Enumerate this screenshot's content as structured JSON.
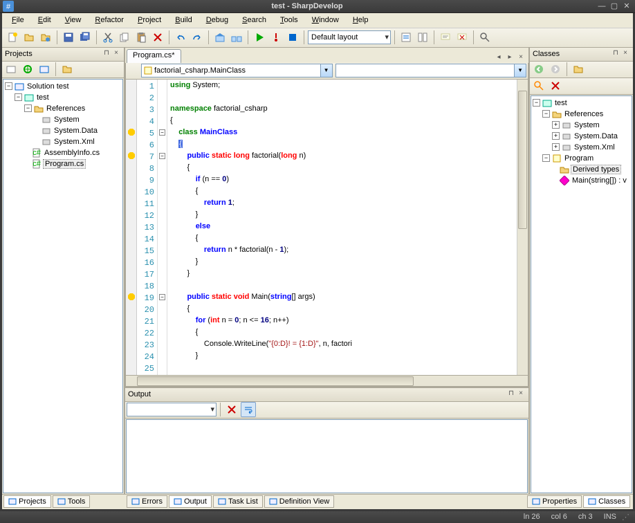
{
  "title": "test - SharpDevelop",
  "menu": [
    "File",
    "Edit",
    "View",
    "Refactor",
    "Project",
    "Build",
    "Debug",
    "Search",
    "Tools",
    "Window",
    "Help"
  ],
  "layout_combo": "Default layout",
  "projects_panel": {
    "title": "Projects",
    "solution": "Solution test",
    "project": "test",
    "references_label": "References",
    "refs": [
      "System",
      "System.Data",
      "System.Xml"
    ],
    "files": [
      "AssemblyInfo.cs",
      "Program.cs"
    ]
  },
  "classes_panel": {
    "title": "Classes",
    "root": "test",
    "references_label": "References",
    "refs": [
      "System",
      "System.Data",
      "System.Xml"
    ],
    "program": "Program",
    "derived": "Derived types",
    "main": "Main(string[]) : v"
  },
  "editor": {
    "tab": "Program.cs*",
    "class_combo": "factorial_csharp.MainClass",
    "lines": [
      {
        "n": 1,
        "tokens": [
          [
            "kw-green",
            "using"
          ],
          [
            "",
            " System;"
          ]
        ]
      },
      {
        "n": 2,
        "tokens": []
      },
      {
        "n": 3,
        "tokens": [
          [
            "kw-green",
            "namespace"
          ],
          [
            "",
            " factorial_csharp"
          ]
        ]
      },
      {
        "n": 4,
        "tokens": [
          [
            "",
            "{"
          ]
        ]
      },
      {
        "n": 5,
        "fold": true,
        "tokens": [
          [
            "",
            "    "
          ],
          [
            "kw-green",
            "class"
          ],
          [
            "",
            " "
          ],
          [
            "kw-blue",
            "MainClass"
          ]
        ]
      },
      {
        "n": 6,
        "tokens": [
          [
            "",
            "    "
          ],
          [
            "highlight-brace",
            "{"
          ]
        ]
      },
      {
        "n": 7,
        "fold": true,
        "tokens": [
          [
            "",
            "        "
          ],
          [
            "kw-blue",
            "public"
          ],
          [
            "",
            " "
          ],
          [
            "kw-red",
            "static"
          ],
          [
            "",
            " "
          ],
          [
            "kw-red",
            "long"
          ],
          [
            "",
            " "
          ],
          [
            "",
            "factorial"
          ],
          [
            "",
            "("
          ],
          [
            "kw-red",
            "long"
          ],
          [
            "",
            " n)"
          ]
        ]
      },
      {
        "n": 8,
        "tokens": [
          [
            "",
            "        {"
          ]
        ]
      },
      {
        "n": 9,
        "tokens": [
          [
            "",
            "            "
          ],
          [
            "kw-blue",
            "if"
          ],
          [
            "",
            " (n == "
          ],
          [
            "num",
            "0"
          ],
          [
            "",
            ")"
          ]
        ]
      },
      {
        "n": 10,
        "tokens": [
          [
            "",
            "            {"
          ]
        ]
      },
      {
        "n": 11,
        "tokens": [
          [
            "",
            "                "
          ],
          [
            "kw-blue",
            "return"
          ],
          [
            "",
            " "
          ],
          [
            "num",
            "1"
          ],
          [
            "",
            ";"
          ]
        ]
      },
      {
        "n": 12,
        "tokens": [
          [
            "",
            "            }"
          ]
        ]
      },
      {
        "n": 13,
        "tokens": [
          [
            "",
            "            "
          ],
          [
            "kw-blue",
            "else"
          ]
        ]
      },
      {
        "n": 14,
        "tokens": [
          [
            "",
            "            {"
          ]
        ]
      },
      {
        "n": 15,
        "tokens": [
          [
            "",
            "                "
          ],
          [
            "kw-blue",
            "return"
          ],
          [
            "",
            " n * "
          ],
          [
            "",
            "factorial"
          ],
          [
            "",
            "(n - "
          ],
          [
            "num",
            "1"
          ],
          [
            "",
            ");"
          ]
        ]
      },
      {
        "n": 16,
        "tokens": [
          [
            "",
            "            }"
          ]
        ]
      },
      {
        "n": 17,
        "tokens": [
          [
            "",
            "        }"
          ]
        ]
      },
      {
        "n": 18,
        "tokens": []
      },
      {
        "n": 19,
        "fold": true,
        "tokens": [
          [
            "",
            "        "
          ],
          [
            "kw-blue",
            "public"
          ],
          [
            "",
            " "
          ],
          [
            "kw-red",
            "static"
          ],
          [
            "",
            " "
          ],
          [
            "kw-red",
            "void"
          ],
          [
            "",
            " "
          ],
          [
            "",
            "Main"
          ],
          [
            "",
            "("
          ],
          [
            "kw-blue",
            "string"
          ],
          [
            "",
            "[] args)"
          ]
        ]
      },
      {
        "n": 20,
        "tokens": [
          [
            "",
            "        {"
          ]
        ]
      },
      {
        "n": 21,
        "tokens": [
          [
            "",
            "            "
          ],
          [
            "kw-blue",
            "for"
          ],
          [
            "",
            " ("
          ],
          [
            "kw-red",
            "int"
          ],
          [
            "",
            " n = "
          ],
          [
            "num",
            "0"
          ],
          [
            "",
            "; n <= "
          ],
          [
            "num",
            "16"
          ],
          [
            "",
            "; n++)"
          ]
        ]
      },
      {
        "n": 22,
        "tokens": [
          [
            "",
            "            {"
          ]
        ]
      },
      {
        "n": 23,
        "tokens": [
          [
            "",
            "                Console."
          ],
          [
            "",
            "WriteLine"
          ],
          [
            "",
            "("
          ],
          [
            "str",
            "\"{0:D}! = {1:D}\""
          ],
          [
            "",
            ", n, "
          ],
          [
            "",
            "factori"
          ]
        ]
      },
      {
        "n": 24,
        "tokens": [
          [
            "",
            "            }"
          ]
        ]
      },
      {
        "n": 25,
        "tokens": []
      }
    ]
  },
  "output_panel": {
    "title": "Output"
  },
  "bottom_tabs_left": [
    "Projects",
    "Tools"
  ],
  "bottom_tabs_center": [
    "Errors",
    "Output",
    "Task List",
    "Definition View"
  ],
  "bottom_tabs_right": [
    "Properties",
    "Classes"
  ],
  "status": {
    "line": "ln 26",
    "col": "col 6",
    "ch": "ch 3",
    "ins": "INS"
  }
}
